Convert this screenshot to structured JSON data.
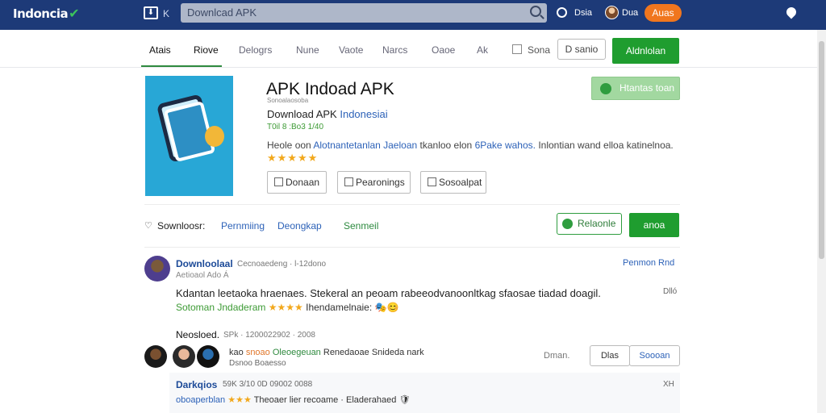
{
  "topbar": {
    "brand": "Indoncia",
    "apk_tag": "K",
    "search_placeholder": "Downlcad APK",
    "globe_label": "Dsia",
    "avatar_label": "Dua",
    "action_button": "Auas"
  },
  "nav": {
    "items": [
      "Atais",
      "Riove",
      "Delogrs",
      "Nune",
      "Vaote",
      "Narcs",
      "Oaoe",
      "Ak"
    ],
    "edit_label": "Sona",
    "outline_button": "D sanio",
    "green_button": "Aldnlolan"
  },
  "app": {
    "title": "APK Indoad APK",
    "small_line": "Sonoalaosoba",
    "subtitle_prefix": "Download APK",
    "subtitle_highlight": "Indonesiai",
    "version": "T0il 8 :Bo3 1/40",
    "desc_start": "Heole oon",
    "desc_blue": "Alotnantetanlan Jaeloan",
    "desc_mid": "tkanloo elon",
    "desc_blue2": "6Pake wahos.",
    "desc_end": "Inlontian wand elloa katinelnoa.",
    "stars": "★★★★★",
    "buttons": [
      "Donaan",
      "Pearonings",
      "Sosoalpat"
    ],
    "verified_label": "Htantas toan"
  },
  "meta_row": {
    "label": "Sownloosr:",
    "link1": "Pernmiing",
    "link2": "Deongkap",
    "link3": "Senmeil",
    "outline_button": "Relaonle",
    "green_button": "anoa"
  },
  "comment": {
    "author": "Downloolaal",
    "meta": "Cecnoaedeng  ·  l-12dono",
    "sub": "Aetioaol Ado  Á",
    "right_link": "Penmon Rnd",
    "right_small": "Dlló",
    "body": "Kdantan leetaoka hraenaes. Stekeral an peoam rabeeodvanoonltkag sfaosae tiadad doagil.",
    "tag_green": "Sotoman Jndaderam",
    "tag_stars": "★★★★",
    "tag_text": "Ihendamelnaie:"
  },
  "related": {
    "title": "Neosloed.",
    "meta": "SPk  ·  1200022902 · 2008",
    "line_prefix": "kao",
    "line_orange": "snoao",
    "line_green": "Oleoegeuan",
    "line_end": "Renedaoae Snideda nark",
    "line2": "Dsnoo Boaesso",
    "damn": "Dman.",
    "btn1": "Dlas",
    "btn2": "Soooan"
  },
  "reply": {
    "author": "Darkqios",
    "meta": "59K  3/10  0D 09002 0088",
    "x": "XH",
    "line_blue": "oboaperblan",
    "line_stars": "★★★",
    "line_text": "Theoaer lier recoame  ·  Eladerahaed"
  }
}
